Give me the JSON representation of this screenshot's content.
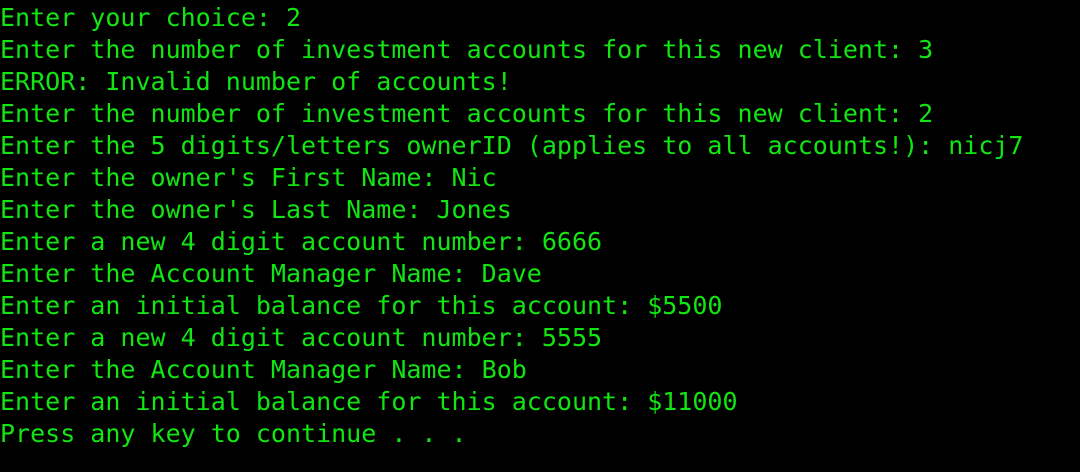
{
  "colors": {
    "background": "#000000",
    "foreground": "#12e612"
  },
  "console": {
    "lines": [
      "Enter your choice: 2",
      "Enter the number of investment accounts for this new client: 3",
      "ERROR: Invalid number of accounts!",
      "Enter the number of investment accounts for this new client: 2",
      "Enter the 5 digits/letters ownerID (applies to all accounts!): nicj7",
      "Enter the owner's First Name: Nic",
      "Enter the owner's Last Name: Jones",
      "Enter a new 4 digit account number: 6666",
      "Enter the Account Manager Name: Dave",
      "Enter an initial balance for this account: $5500",
      "Enter a new 4 digit account number: 5555",
      "Enter the Account Manager Name: Bob",
      "Enter an initial balance for this account: $11000",
      "Press any key to continue . . ."
    ]
  }
}
